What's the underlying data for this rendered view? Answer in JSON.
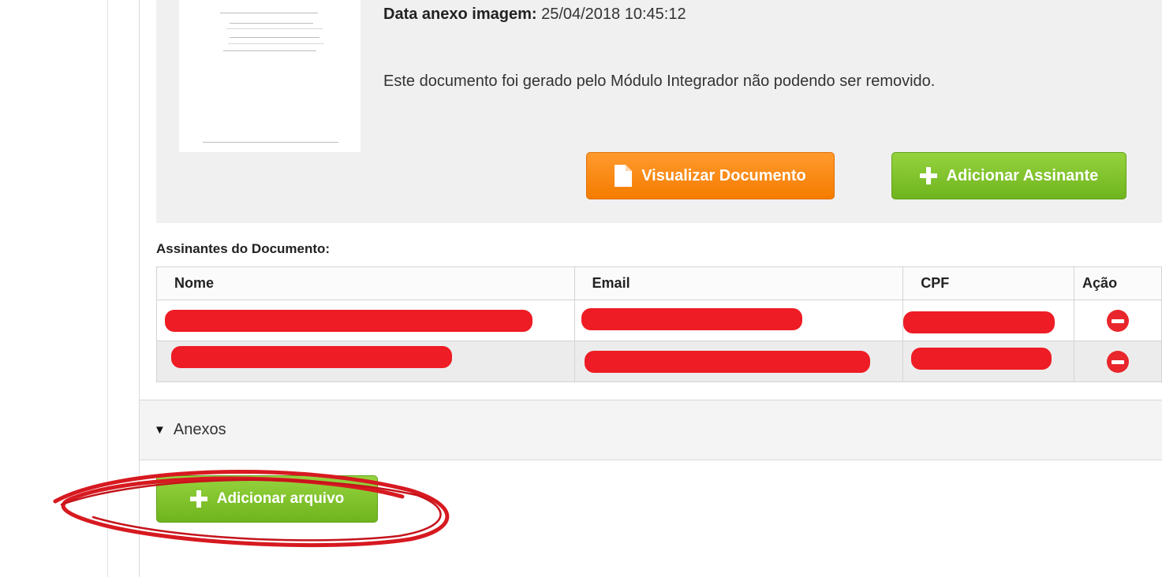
{
  "document": {
    "date_label": "Data anexo imagem:",
    "date_value": "25/04/2018 10:45:12",
    "message": "Este documento foi gerado pelo Módulo Integrador não podendo ser removido.",
    "view_button": "Visualizar Documento",
    "add_signer_button": "Adicionar Assinante"
  },
  "signers": {
    "title": "Assinantes do Documento:",
    "columns": [
      "Nome",
      "Email",
      "CPF",
      "Ação"
    ],
    "rows": [
      {
        "name": "",
        "email": "",
        "cpf": ""
      },
      {
        "name": "",
        "email": "",
        "cpf": ""
      }
    ]
  },
  "attachments": {
    "section_label": "Anexos",
    "add_file_button": "Adicionar arquivo"
  },
  "colors": {
    "orange_button": "#f57c00",
    "green_button": "#6fb41e",
    "redaction": "#ee1c24",
    "annotation": "#d71920"
  },
  "icons": {
    "view_button": "document-icon",
    "add_buttons": "plus-icon",
    "row_action": "remove-icon",
    "section_toggle": "triangle-down-icon"
  }
}
